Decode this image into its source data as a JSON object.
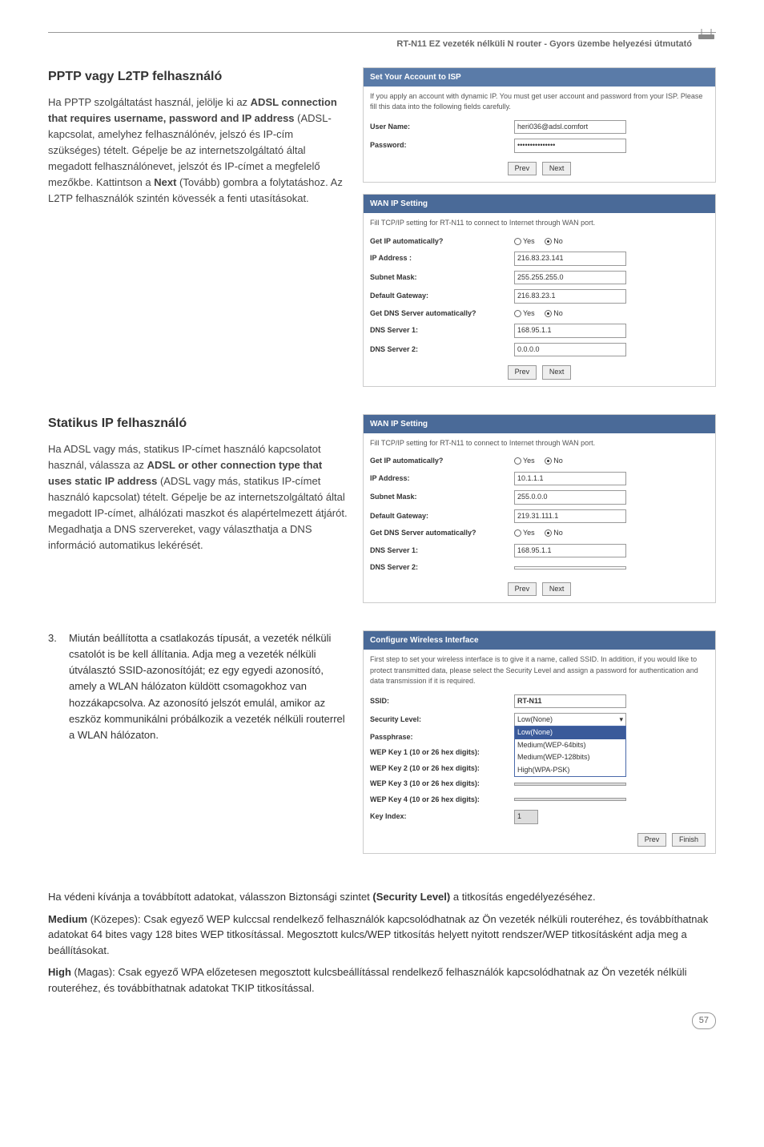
{
  "header": {
    "title": "RT-N11 EZ vezeték nélküli N router - Gyors üzembe helyezési útmutató"
  },
  "section_pptp": {
    "heading": "PPTP vagy L2TP felhasználó",
    "body": "Ha PPTP szolgáltatást használ, jelölje ki az <strong>ADSL connection that requires username, password and IP address</strong> (ADSL-kapcsolat, amelyhez felhasználónév, jelszó és IP-cím szükséges) tételt. Gépelje be az internetszolgáltató által megadott felhasználónevet, jelszót és IP-címet a megfelelő mezőkbe. Kattintson a <strong>Next</strong> (Tovább) gombra a folytatáshoz. Az L2TP felhasználók szintén kövessék a fenti utasításokat."
  },
  "section_static": {
    "heading": "Statikus IP felhasználó",
    "body": "Ha ADSL vagy más, statikus IP-címet használó kapcsolatot használ, válassza az <strong>ADSL or other connection type that uses static IP address</strong> (ADSL vagy más, statikus IP-címet használó kapcsolat) tételt. Gépelje be az internetszolgáltató által megadott IP-címet, alhálózati maszkot és alapértelmezett átjárót. Megadhatja a DNS szervereket, vagy választhatja a DNS információ automatikus lekérését."
  },
  "list_item_3": {
    "num": "3.",
    "text": "Miután beállította a csatlakozás típusát, a vezeték nélküli csatolót is be kell állítania. Adja meg a vezeték nélküli útválasztó SSID-azonosítóját; ez egy egyedi azonosító, amely a WLAN hálózaton küldött csomagokhoz van hozzákapcsolva. Az azonosító jelszót emulál, amikor az eszköz kommunikálni próbálkozik a vezeték nélküli routerrel a WLAN hálózaton."
  },
  "panel_isp": {
    "title": "Set Your Account to ISP",
    "desc": "If you apply an account with dynamic IP. You must get user account and password from your ISP. Please fill this data into the following fields carefully.",
    "username_label": "User Name:",
    "username_value": "heri036@adsl.comfort",
    "password_label": "Password:",
    "password_value": "•••••••••••••••",
    "btn_prev": "Prev",
    "btn_next": "Next"
  },
  "panel_wan1": {
    "title": "WAN IP Setting",
    "desc": "Fill TCP/IP setting for RT-N11 to connect to Internet through WAN port.",
    "auto_ip_label": "Get IP automatically?",
    "ip_label": "IP Address :",
    "ip_value": "216.83.23.141",
    "mask_label": "Subnet Mask:",
    "mask_value": "255.255.255.0",
    "gw_label": "Default Gateway:",
    "gw_value": "216.83.23.1",
    "auto_dns_label": "Get DNS Server automatically?",
    "dns1_label": "DNS Server 1:",
    "dns1_value": "168.95.1.1",
    "dns2_label": "DNS Server 2:",
    "dns2_value": "0.0.0.0",
    "yes": "Yes",
    "no": "No",
    "btn_prev": "Prev",
    "btn_next": "Next"
  },
  "panel_wan2": {
    "title": "WAN IP Setting",
    "desc": "Fill TCP/IP setting for RT-N11 to connect to Internet through WAN port.",
    "auto_ip_label": "Get IP automatically?",
    "ip_label": "IP Address:",
    "ip_value": "10.1.1.1",
    "mask_label": "Subnet Mask:",
    "mask_value": "255.0.0.0",
    "gw_label": "Default Gateway:",
    "gw_value": "219.31.111.1",
    "auto_dns_label": "Get DNS Server automatically?",
    "dns1_label": "DNS Server 1:",
    "dns1_value": "168.95.1.1",
    "dns2_label": "DNS Server 2:",
    "dns2_value": "",
    "yes": "Yes",
    "no": "No",
    "btn_prev": "Prev",
    "btn_next": "Next"
  },
  "panel_wireless": {
    "title": "Configure Wireless Interface",
    "desc": "First step to set your wireless interface is to give it a name, called SSID. In addition, if you would like to protect transmitted data, please select the Security Level and assign a password for authentication and data transmission if it is required.",
    "ssid_label": "SSID:",
    "ssid_value": "RT-N11",
    "seclevel_label": "Security Level:",
    "seclevel_value": "Low(None)",
    "opt1": "Low(None)",
    "opt2": "Medium(WEP-64bits)",
    "opt3": "Medium(WEP-128bits)",
    "opt4": "High(WPA-PSK)",
    "pass_label": "Passphrase:",
    "wep1_label": "WEP Key 1 (10 or 26 hex digits):",
    "wep2_label": "WEP Key 2 (10 or 26 hex digits):",
    "wep3_label": "WEP Key 3 (10 or 26 hex digits):",
    "wep4_label": "WEP Key 4 (10 or 26 hex digits):",
    "keyidx_label": "Key Index:",
    "keyidx_value": "1",
    "btn_prev": "Prev",
    "btn_finish": "Finish"
  },
  "bottom": {
    "p1": "Ha védeni kívánja a továbbított adatokat, válasszon Biztonsági szintet <strong>(Security Level)</strong> a titkosítás engedélyezéséhez.",
    "p2": "<strong>Medium</strong> (Közepes): Csak egyező WEP kulccsal rendelkező felhasználók kapcsolódhatnak az Ön vezeték nélküli routeréhez, és továbbíthatnak adatokat 64 bites vagy 128 bites WEP titkosítással. Megosztott kulcs/WEP titkosítás helyett nyitott rendszer/WEP titkosításként adja meg a beállításokat.",
    "p3": "<strong>High</strong> (Magas): Csak egyező WPA előzetesen megosztott kulcsbeállítással rendelkező felhasználók kapcsolódhatnak az Ön vezeték nélküli routeréhez, és továbbíthatnak adatokat TKIP titkosítással."
  },
  "page_number": "57"
}
